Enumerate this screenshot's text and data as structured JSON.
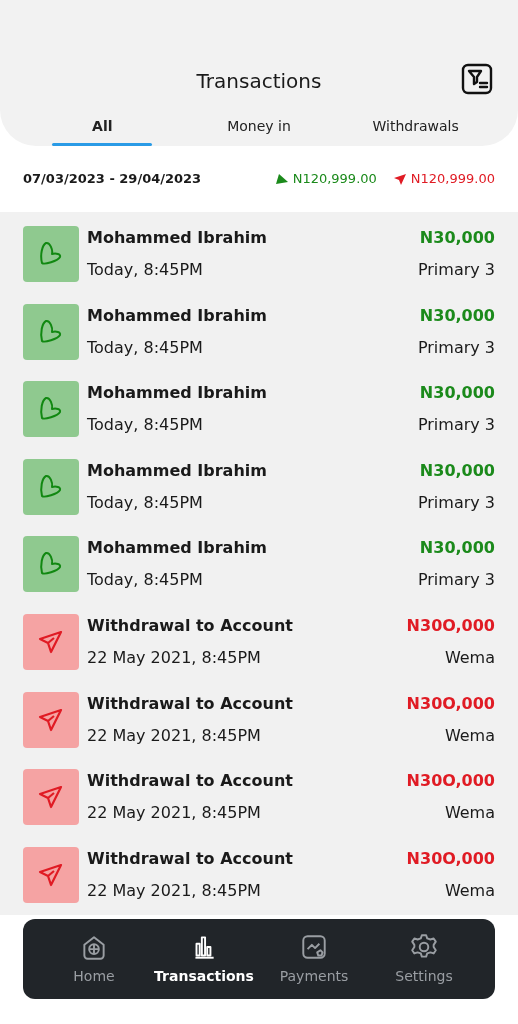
{
  "header": {
    "title": "Transactions"
  },
  "tabs": [
    {
      "label": "All",
      "selected": true
    },
    {
      "label": "Money in",
      "selected": false
    },
    {
      "label": "Withdrawals",
      "selected": false
    }
  ],
  "summary": {
    "date_range": "07/03/2023 - 29/04/2023",
    "money_in": "N120,999.00",
    "money_out": "N120,999.00"
  },
  "transactions": [
    {
      "kind": "in",
      "title": "Mohammed Ibrahim",
      "time": "Today, 8:45PM",
      "amount": "N30,000",
      "account": "Primary 3"
    },
    {
      "kind": "in",
      "title": "Mohammed Ibrahim",
      "time": "Today, 8:45PM",
      "amount": "N30,000",
      "account": "Primary 3"
    },
    {
      "kind": "in",
      "title": "Mohammed Ibrahim",
      "time": "Today, 8:45PM",
      "amount": "N30,000",
      "account": "Primary 3"
    },
    {
      "kind": "in",
      "title": "Mohammed Ibrahim",
      "time": "Today, 8:45PM",
      "amount": "N30,000",
      "account": "Primary 3"
    },
    {
      "kind": "in",
      "title": "Mohammed Ibrahim",
      "time": "Today, 8:45PM",
      "amount": "N30,000",
      "account": "Primary 3"
    },
    {
      "kind": "out",
      "title": "Withdrawal to Account",
      "time": "22 May 2021, 8:45PM",
      "amount": "N30O,000",
      "account": "Wema"
    },
    {
      "kind": "out",
      "title": "Withdrawal to Account",
      "time": "22 May 2021, 8:45PM",
      "amount": "N30O,000",
      "account": "Wema"
    },
    {
      "kind": "out",
      "title": "Withdrawal to Account",
      "time": "22 May 2021, 8:45PM",
      "amount": "N30O,000",
      "account": "Wema"
    },
    {
      "kind": "out",
      "title": "Withdrawal to Account",
      "time": "22 May 2021, 8:45PM",
      "amount": "N30O,000",
      "account": "Wema"
    }
  ],
  "bottom_nav": [
    {
      "kind": "home",
      "label": "Home",
      "selected": false
    },
    {
      "kind": "transactions",
      "label": "Transactions",
      "selected": true
    },
    {
      "kind": "payments",
      "label": "Payments",
      "selected": false
    },
    {
      "kind": "settings",
      "label": "Settings",
      "selected": false
    }
  ]
}
